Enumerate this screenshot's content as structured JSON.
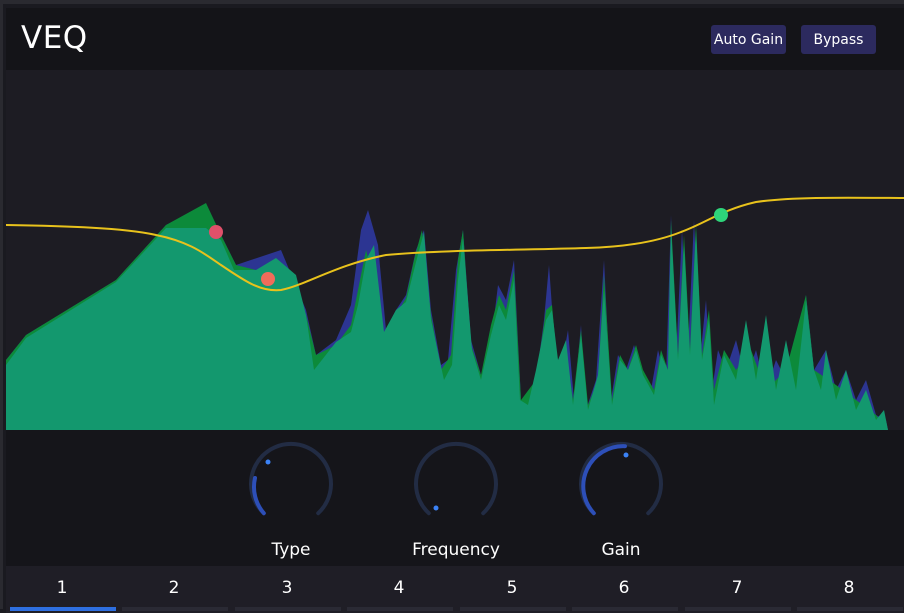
{
  "app": {
    "title": "VEQ"
  },
  "header": {
    "auto_gain_label": "Auto Gain",
    "bypass_label": "Bypass"
  },
  "colors": {
    "accent": "#2e6fe0",
    "button_bg": "#2c2a5e",
    "spectrum_fill": "#13986e",
    "spectrum_peak_green": "#0c8a3a",
    "spectrum_peak_blue": "#2c3592",
    "eq_curve": "#e8c21c",
    "node_1": "#e0506a",
    "node_2": "#f06c5a",
    "node_3": "#2ed47a",
    "knob_track": "#222c44",
    "knob_value": "#2d4fb8",
    "knob_dot": "#3b82f6"
  },
  "knobs": [
    {
      "label": "Type",
      "value": 0.08
    },
    {
      "label": "Frequency",
      "value": 0.0
    },
    {
      "label": "Gain",
      "value": 0.5
    }
  ],
  "bands": {
    "active_index": 0,
    "items": [
      "1",
      "2",
      "3",
      "4",
      "5",
      "6",
      "7",
      "8"
    ]
  }
}
